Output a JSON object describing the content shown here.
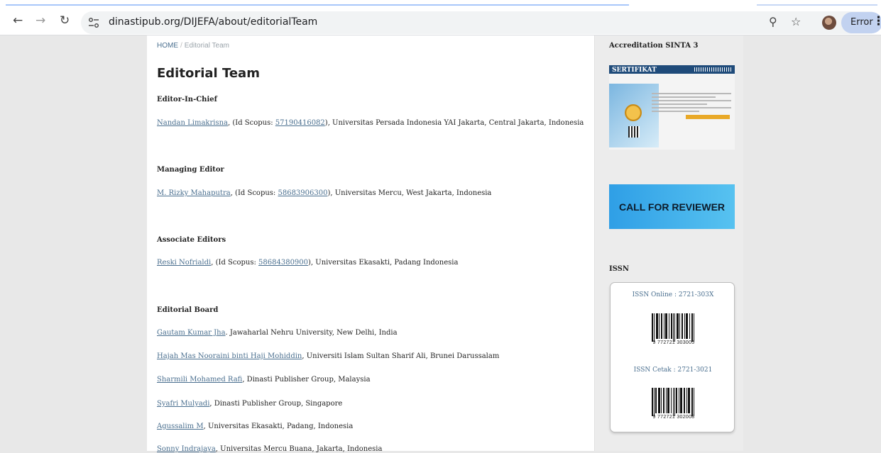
{
  "browser": {
    "url": "dinastipub.org/DIJEFA/about/editorialTeam",
    "profile_button": "Error",
    "icons": [
      "back-icon",
      "forward-icon",
      "reload-icon",
      "site-settings-icon",
      "zoom-icon",
      "star-icon",
      "avatar",
      "more-icon"
    ]
  },
  "breadcrumb": {
    "home": "HOME",
    "separator": "/",
    "current": "Editorial Team"
  },
  "page_title": "Editorial Team",
  "sections": {
    "chief": {
      "heading": "Editor-In-Chief",
      "name": "Nandan Limakrisna",
      "pre": ", (Id Scopus: ",
      "scopus": "57190416082",
      "post": "), Universitas Persada Indonesia YAI Jakarta, Central Jakarta, Indonesia"
    },
    "managing": {
      "heading": "Managing Editor",
      "name": "M. Rizky Mahaputra",
      "pre": ", (Id Scopus: ",
      "scopus": "58683906300",
      "post": "), Universitas Mercu, West Jakarta, Indonesia"
    },
    "associate": {
      "heading": "Associate Editors",
      "name": "Reski Nofrialdi",
      "pre": ", (Id Scopus: ",
      "scopus": "58684380900",
      "post": "), Universitas Ekasakti, Padang Indonesia"
    },
    "board": {
      "heading": "Editorial Board",
      "members": [
        {
          "name": "Gautam Kumar Jha",
          "rest": ". Jawaharlal Nehru University, New Delhi, India"
        },
        {
          "name": "Hajah Mas Nooraini binti Haji Mohiddin",
          "rest": ", Universiti Islam Sultan Sharif Ali, Brunei Darussalam"
        },
        {
          "name": "Sharmili Mohamed Rafi",
          "rest": ", Dinasti Publisher Group, Malaysia"
        },
        {
          "name": "Syafri Mulyadi",
          "rest": ", Dinasti Publisher Group, Singapore"
        },
        {
          "name": "Agussalim M",
          "rest": ", Universitas Ekasakti, Padang, Indonesia"
        },
        {
          "name": "Sonny Indrajaya",
          "rest": ", Universitas Mercu Buana, Jakarta, Indonesia"
        }
      ]
    }
  },
  "sidebar": {
    "accreditation_title": "Accreditation SINTA 3",
    "certificate_heading": "SERTIFIKAT",
    "call_for_reviewer": "CALL FOR REVIEWER",
    "issn_title": "ISSN",
    "issn_online": "ISSN Online : 2721-303X",
    "issn_online_barcode": "9 772721 303005",
    "issn_print": "ISSN Cetak : 2721-3021",
    "issn_print_barcode": "9 772721 302008"
  }
}
